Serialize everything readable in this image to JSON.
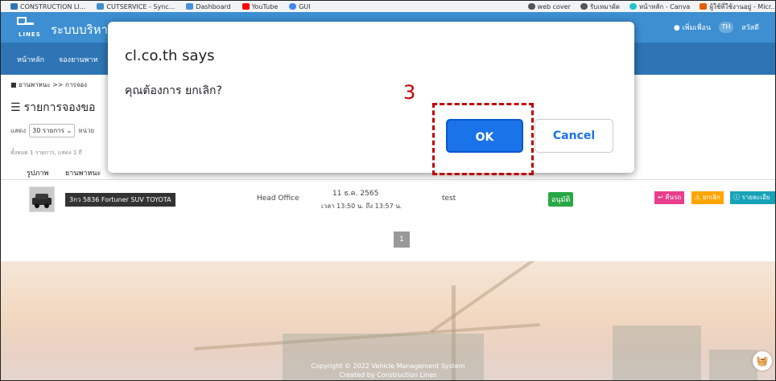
{
  "bookmarks": {
    "left": [
      {
        "label": "CONSTRUCTION LI...",
        "icon": "construction-lines-icon",
        "color": "#2f75b5"
      },
      {
        "label": "CUTSERVICE - Sync...",
        "icon": "cutservice-icon",
        "color": "#3d8fd1"
      },
      {
        "label": "Dashboard",
        "icon": "dashboard-icon",
        "color": "#4a90d9"
      },
      {
        "label": "YouTube",
        "icon": "youtube-icon",
        "color": "#ff0000"
      },
      {
        "label": "GUI",
        "icon": "google-icon",
        "color": "#4285f4"
      }
    ],
    "right": [
      {
        "label": "web cover",
        "icon": "web-cover-icon"
      },
      {
        "label": "รับเหมาผัด",
        "icon": "globe-icon"
      },
      {
        "label": "หน้าหลัก - Canva",
        "icon": "canva-icon"
      },
      {
        "label": "ผู้ใช้ที่ใช้งานอยู่ - Micr...",
        "icon": "office-icon"
      }
    ]
  },
  "header": {
    "logo_text": "LINES",
    "title": "ระบบบริหาร",
    "add_friend": "เพิ่มเพื่อน",
    "avatar_initials": "TH",
    "greeting": "สวัสดี"
  },
  "nav": {
    "items": [
      "หน้าหลัก",
      "จองยานพาห"
    ]
  },
  "breadcrumb": "ยานพาหนะ >> การจอง",
  "page_title": "รายการจองขอ",
  "controls": {
    "show_label": "แสดง",
    "page_size": "30 รายการ",
    "unit_label": "หน่วย"
  },
  "summary": "ทั้งหมด 1 รายการ, แสดง 1 ถึ",
  "table": {
    "headers": [
      "รูปภาพ",
      "ยานพาหนะ"
    ],
    "rows": [
      {
        "vehicle": "3กว 5836 Fortuner SUV TOYOTA",
        "location": "Head Office",
        "date": "11 ธ.ค. 2565",
        "time": "เวลา 13:50 น. ถึง 13:57 น.",
        "note": "test",
        "status": "อนุมัติ"
      }
    ],
    "actions": {
      "return_label": "คืนรถ",
      "cancel_label": "ยกเลิก",
      "detail_label": "รายละเอีย"
    }
  },
  "pagination": {
    "current": "1"
  },
  "footer": {
    "copyright": "Copyright © 2022 Vehicle Management System",
    "created_by": "Created by Construction Lines"
  },
  "dialog": {
    "title": "cl.co.th says",
    "message": "คุณต้องการ ยกเลิก?",
    "ok_label": "OK",
    "cancel_label": "Cancel"
  },
  "annotation": {
    "step_number": "3",
    "color": "#c00000"
  },
  "colors": {
    "header_blue": "#3d8fd1",
    "nav_blue": "#2f75b5",
    "approved_green": "#28a745",
    "return_pink": "#e83e8c",
    "cancel_orange": "#ffa500",
    "detail_blue": "#17a2b8",
    "dialog_ok_blue": "#1a73e8"
  }
}
